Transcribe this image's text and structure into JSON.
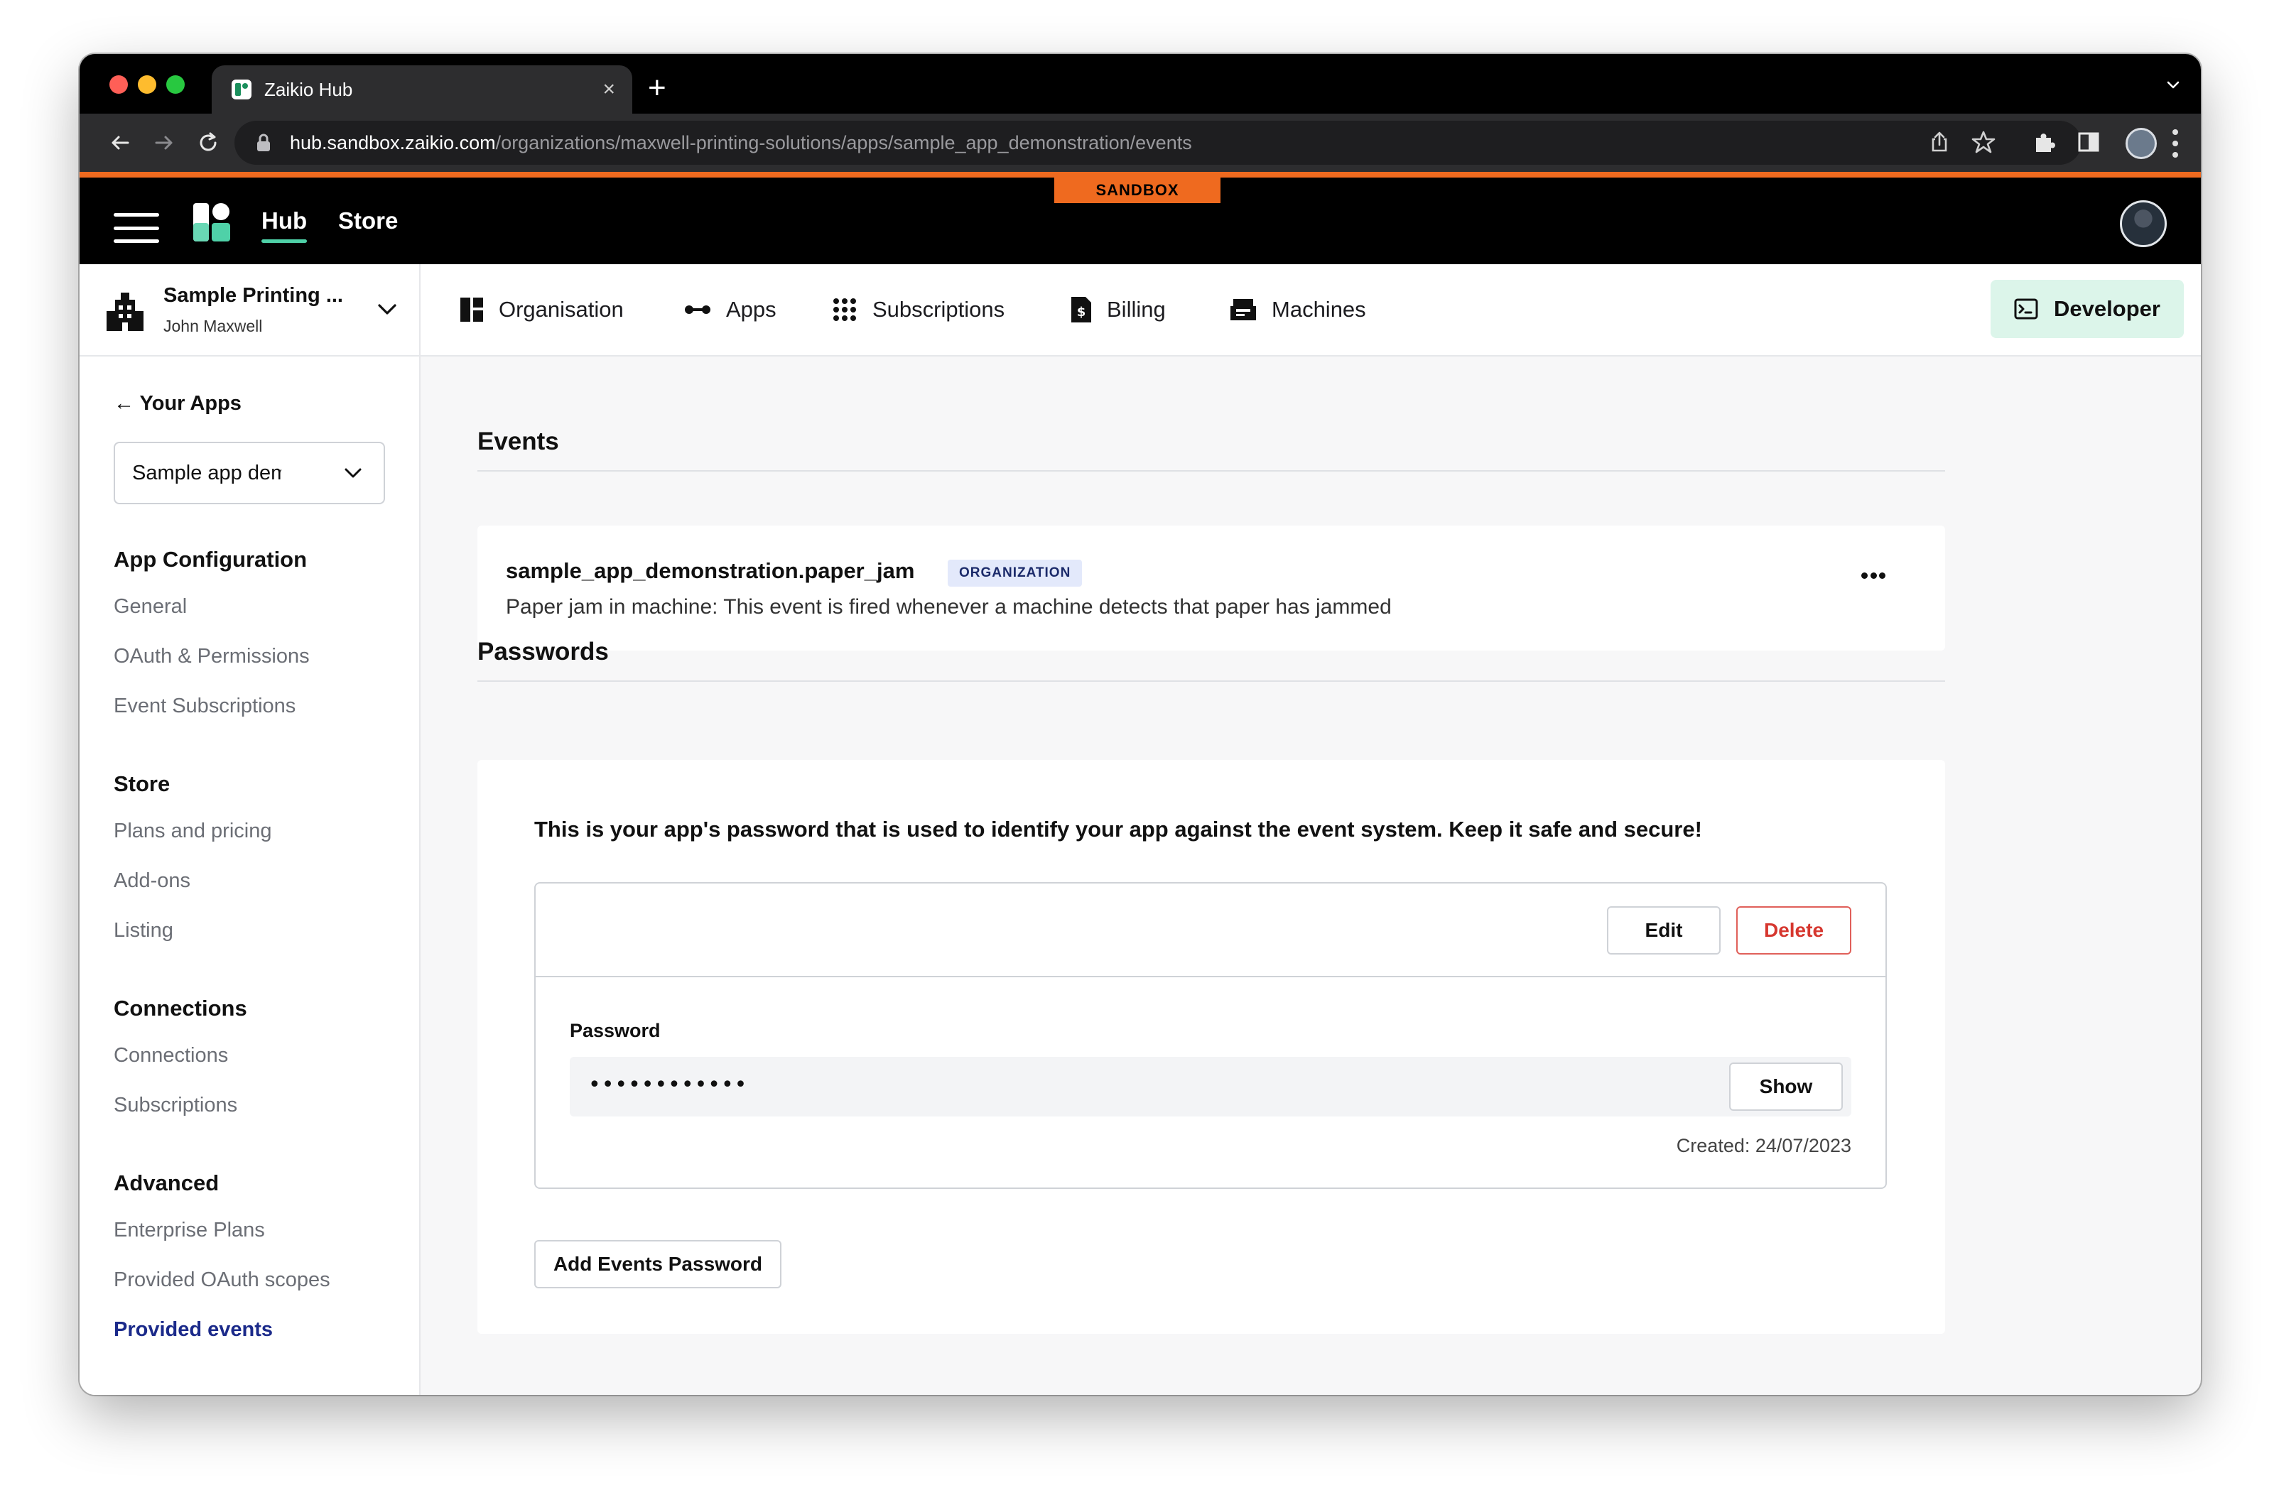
{
  "browser": {
    "tab_title": "Zaikio Hub",
    "tab_close": "×",
    "new_tab": "+",
    "url_host": "hub.sandbox.zaikio.com",
    "url_path": "/organizations/maxwell-printing-solutions/apps/sample_app_demonstration/events"
  },
  "header": {
    "environment_badge": "SANDBOX",
    "nav": {
      "hub": "Hub",
      "store": "Store"
    },
    "accent_color": "#ef6a1f"
  },
  "org": {
    "name": "Sample Printing ...",
    "user": "John Maxwell",
    "nav": [
      {
        "label": "Organisation",
        "icon": "dashboard-icon"
      },
      {
        "label": "Apps",
        "icon": "connection-icon"
      },
      {
        "label": "Subscriptions",
        "icon": "grid-icon"
      },
      {
        "label": "Billing",
        "icon": "invoice-icon"
      },
      {
        "label": "Machines",
        "icon": "machine-icon"
      }
    ],
    "developer_label": "Developer"
  },
  "sidebar": {
    "back_label": "← Your Apps",
    "app_select_value": "Sample app demonstration",
    "sections": [
      {
        "heading": "App Configuration",
        "items": [
          "General",
          "OAuth & Permissions",
          "Event Subscriptions"
        ]
      },
      {
        "heading": "Store",
        "items": [
          "Plans and pricing",
          "Add-ons",
          "Listing"
        ]
      },
      {
        "heading": "Connections",
        "items": [
          "Connections",
          "Subscriptions"
        ]
      },
      {
        "heading": "Advanced",
        "items": [
          "Enterprise Plans",
          "Provided OAuth scopes",
          "Provided events"
        ]
      }
    ],
    "active_item": "Provided events"
  },
  "events": {
    "title": "Events",
    "items": [
      {
        "name": "sample_app_demonstration.paper_jam",
        "badge": "ORGANIZATION",
        "description": "Paper jam in machine: This event is fired whenever a machine detects that paper has jammed"
      }
    ]
  },
  "passwords": {
    "title": "Passwords",
    "intro": "This is your app's password that is used to identify your app against the event system. Keep it safe and secure!",
    "edit_label": "Edit",
    "delete_label": "Delete",
    "field_label": "Password",
    "masked_value": "••••••••••••",
    "show_label": "Show",
    "created": "Created: 24/07/2023",
    "add_label": "Add Events Password"
  }
}
